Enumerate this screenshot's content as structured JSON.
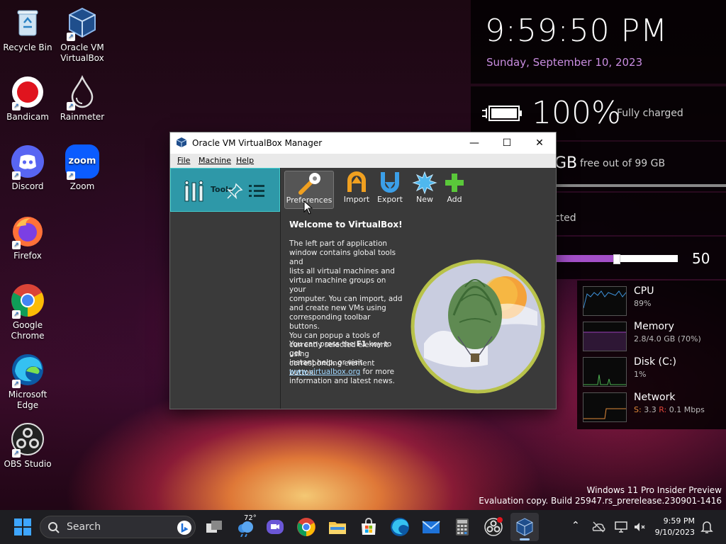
{
  "desktop": {
    "icons": [
      {
        "label_line1": "Recycle Bin",
        "label_line2": ""
      },
      {
        "label_line1": "Oracle VM",
        "label_line2": "VirtualBox"
      },
      {
        "label_line1": "Bandicam",
        "label_line2": ""
      },
      {
        "label_line1": "Rainmeter",
        "label_line2": ""
      },
      {
        "label_line1": "Discord",
        "label_line2": ""
      },
      {
        "label_line1": "Zoom",
        "label_line2": ""
      },
      {
        "label_line1": "Firefox",
        "label_line2": ""
      },
      {
        "label_line1": "Google",
        "label_line2": "Chrome"
      },
      {
        "label_line1": "Microsoft",
        "label_line2": "Edge"
      },
      {
        "label_line1": "OBS Studio",
        "label_line2": ""
      }
    ],
    "zoom_logo_text": "zoom"
  },
  "rainmeter": {
    "time": "9:59:50 PM",
    "date": "Sunday, September 10, 2023",
    "battery_percent": "100%",
    "battery_status": "Fully charged",
    "disk_unit": "GB",
    "disk_text": "free out of 99 GB",
    "wifi_text": "cted",
    "volume_value": "50",
    "volume_level": 0.5,
    "sys": {
      "cpu_name": "CPU",
      "cpu_val": "89%",
      "mem_name": "Memory",
      "mem_val": "2.8/4.0 GB (70%)",
      "disk_name": "Disk (C:)",
      "disk_val": "1%",
      "net_name": "Network",
      "net_s_label": "S:",
      "net_s_val": "3.3",
      "net_r_label": "R:",
      "net_r_val": "0.1 Mbps"
    },
    "accent": "#c98de0"
  },
  "vbox": {
    "title": "Oracle VM VirtualBox Manager",
    "menu": {
      "file": "File",
      "machine": "Machine",
      "help": "Help"
    },
    "tools_label": "Tools",
    "toolbar": {
      "preferences": "Preferences",
      "import": "Import",
      "export": "Export",
      "new": "New",
      "add": "Add"
    },
    "welcome_title": "Welcome to VirtualBox!",
    "para1": [
      "The left part of application",
      "window contains global tools and",
      "lists all virtual machines and",
      "virtual machine groups on your",
      "computer. You can import, add",
      "and create new VMs using",
      "corresponding toolbar buttons.",
      "You can popup a tools of",
      "currently selected element using",
      "corresponding element button."
    ],
    "para2_line1_pre": "You can press the ",
    "para2_key": "F1",
    "para2_line1_post": " key to get",
    "para2_line2": "instant help, or visit",
    "para2_link": "www.virtualbox.org",
    "para2_line3_post": " for more",
    "para2_line4": "information and latest news.",
    "accent": "#2e98a8"
  },
  "watermark": {
    "line1": "Windows 11 Pro Insider Preview",
    "line2": "Evaluation copy. Build 25947.rs_prerelease.230901-1416"
  },
  "taskbar": {
    "search_placeholder": "Search",
    "weather_temp": "72°",
    "clock_time": "9:59 PM",
    "clock_date": "9/10/2023"
  }
}
